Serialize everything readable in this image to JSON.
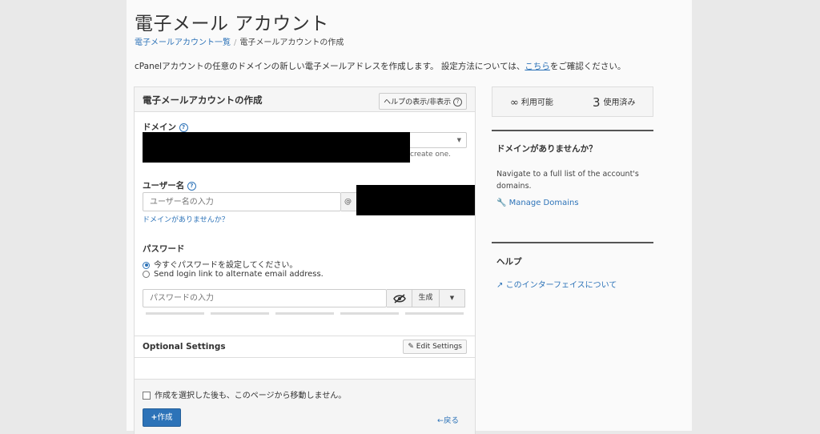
{
  "header": {
    "title": "電子メール アカウント",
    "breadcrumb": [
      "電子メールアカウント一覧",
      "電子メールアカウントの作成"
    ],
    "intro_text": "cPanelアカウントの任意のドメインの新しい電子メールアドレスを作成します。 設定方法については、",
    "intro_link": "こちら",
    "intro_suffix": "をご確認ください。"
  },
  "form": {
    "title": "電子メールアカウントの作成",
    "help_toggle_label": "ヘルプの表示/非表示",
    "domain": {
      "label": "ドメイン",
      "hint": "create one."
    },
    "username": {
      "label": "ユーザー名",
      "placeholder": "ユーザー名の入力",
      "at": "@",
      "no_domain_link": "ドメインがありませんか？"
    },
    "password": {
      "label": "パスワード",
      "option_now": "今すぐパスワードを設定してください。",
      "option_link": "Send login link to alternate email address.",
      "placeholder": "パスワードの入力",
      "generate_label": "生成"
    },
    "optional": {
      "title": "Optional Settings",
      "edit_label": "Edit Settings"
    },
    "stay_label": "作成を選択した後も、このページから移動しません。",
    "create_label": "作成",
    "back_label": "戻る"
  },
  "stats": {
    "available_symbol": "∞",
    "available_label": "利用可能",
    "used_count": "3",
    "used_label": "使用済み"
  },
  "sidebar": {
    "no_domain": {
      "heading": "ドメインがありませんか？",
      "text": "Navigate to a full list of the account's domains.",
      "link": "Manage Domains"
    },
    "help": {
      "heading": "ヘルプ",
      "link": "このインターフェイスについて"
    }
  },
  "colors": {
    "accent": "#2d73b8",
    "redaction": "#000000"
  },
  "icons": {
    "help": "question-circle-icon",
    "eye": "eye-slash-icon",
    "edit": "pencil-icon",
    "plus": "plus-icon",
    "back": "arrow-left-icon",
    "wrench": "wrench-icon",
    "external": "external-link-icon",
    "dropdown": "caret-down-icon"
  }
}
